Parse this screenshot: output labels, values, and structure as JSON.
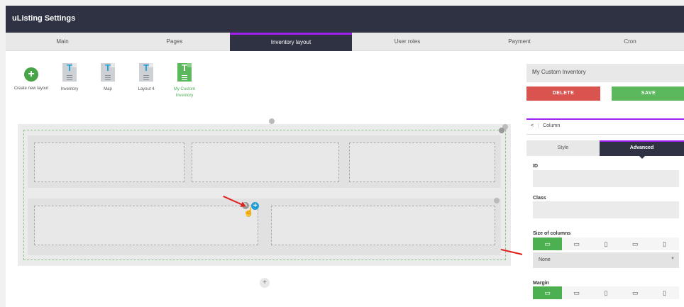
{
  "app": {
    "title": "uListing Settings"
  },
  "tabs": [
    {
      "label": "Main"
    },
    {
      "label": "Pages"
    },
    {
      "label": "Inventory layout"
    },
    {
      "label": "User roles"
    },
    {
      "label": "Payment"
    },
    {
      "label": "Cron"
    }
  ],
  "layouts": {
    "create": "Create new layout",
    "items": [
      {
        "label": "Inventory"
      },
      {
        "label": "Map"
      },
      {
        "label": "Layout 4"
      },
      {
        "label": "My Custom Inventory"
      }
    ]
  },
  "builder": {
    "add_row_symbol": "+",
    "edit_symbol": "✎",
    "add_symbol": "+"
  },
  "sidebar": {
    "layout_name": "My Custom Inventory",
    "delete_label": "DELETE",
    "save_label": "SAVE",
    "back_symbol": "<",
    "panel_title": "Column",
    "subtabs": [
      {
        "label": "Style"
      },
      {
        "label": "Advanced"
      }
    ],
    "id_label": "ID",
    "class_label": "Class",
    "size_label": "Size of columns",
    "size_value": "None",
    "margin_label": "Margin",
    "devices": [
      "desktop",
      "laptop",
      "tablet",
      "tablet-landscape",
      "mobile"
    ]
  },
  "colors": {
    "accent": "#a020f0",
    "dark": "#2e3242",
    "green": "#5cb85c",
    "red": "#d9534f",
    "blue": "#1e9fd6"
  }
}
